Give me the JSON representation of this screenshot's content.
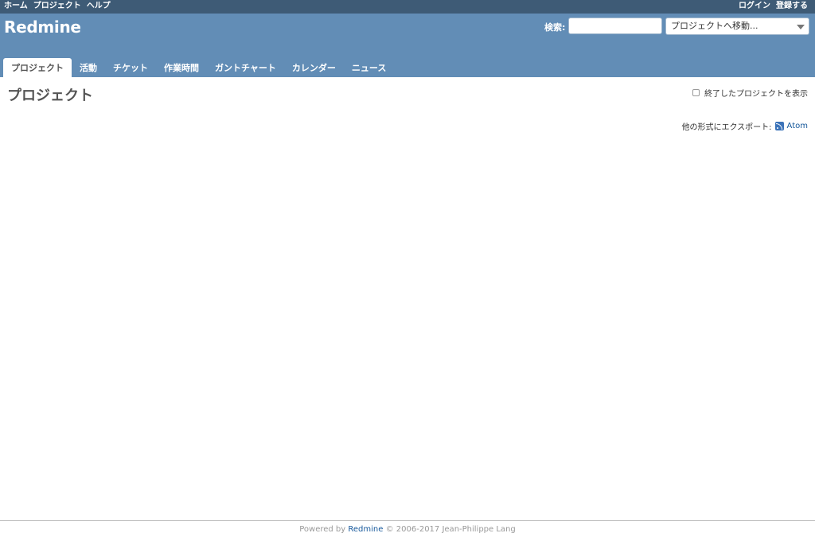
{
  "top_menu": {
    "left": [
      "ホーム",
      "プロジェクト",
      "ヘルプ"
    ],
    "right": [
      "ログイン",
      "登録する"
    ]
  },
  "header": {
    "title": "Redmine",
    "search_label": "検索:",
    "search_value": "",
    "project_jump": "プロジェクトへ移動..."
  },
  "main_menu": {
    "tabs": [
      "プロジェクト",
      "活動",
      "チケット",
      "作業時間",
      "ガントチャート",
      "カレンダー",
      "ニュース"
    ],
    "selected_index": 0
  },
  "content": {
    "title": "プロジェクト",
    "show_closed_label": "終了したプロジェクトを表示",
    "show_closed_checked": false,
    "export_label": "他の形式にエクスポート:",
    "atom_label": "Atom"
  },
  "footer": {
    "prefix": "Powered by",
    "link": "Redmine",
    "suffix": "© 2006-2017 Jean-Philippe Lang"
  },
  "colors": {
    "top_menu_bg": "#3e5b76",
    "header_bg": "#628db6",
    "link": "#16589b"
  },
  "icons": [
    "dropdown-arrow-icon",
    "feed-icon"
  ]
}
